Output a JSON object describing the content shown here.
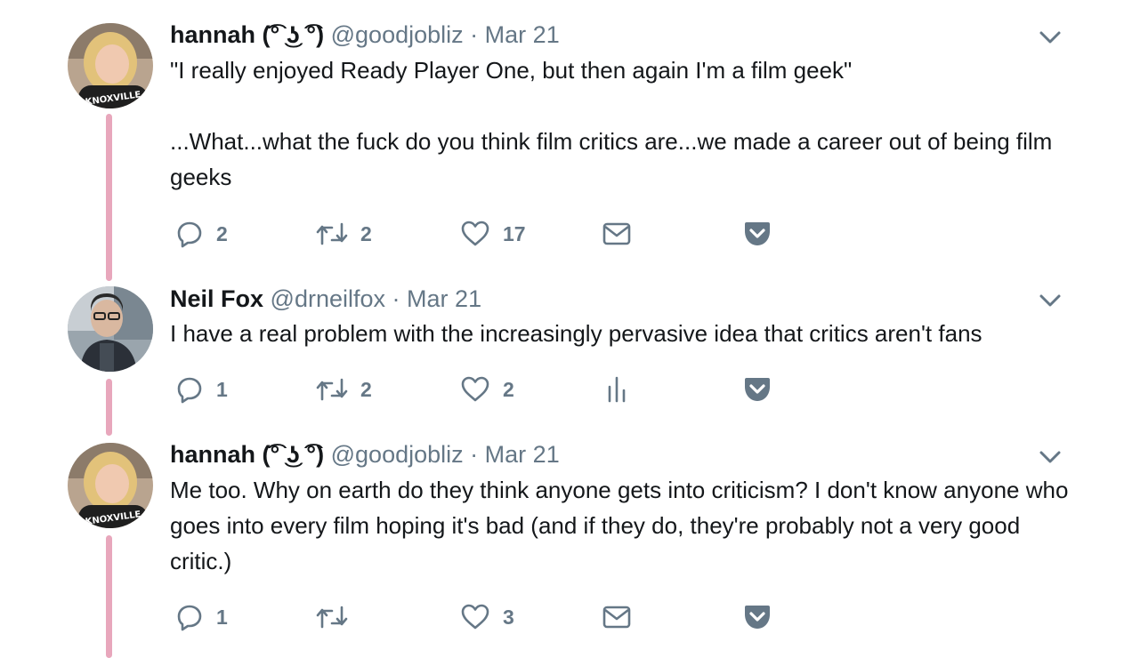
{
  "tweets": [
    {
      "name": "hannah (͡° ͜ʖ ͡°)",
      "handle": "@goodjobliz",
      "separator": "·",
      "date": "Mar 21",
      "paragraphs": [
        "\"I really enjoyed Ready Player One, but then again I'm a film geek\"",
        "...What...what the fuck do you think film critics are...we made a career out of being film geeks"
      ],
      "replies": "2",
      "retweets": "2",
      "likes": "17",
      "fourth_action_icon": "envelope-icon",
      "avatar_shirt_text": "KNOXVILLE"
    },
    {
      "name": "Neil Fox",
      "handle": "@drneilfox",
      "separator": "·",
      "date": "Mar 21",
      "paragraphs": [
        "I have a real problem with the increasingly pervasive idea that critics aren't fans"
      ],
      "replies": "1",
      "retweets": "2",
      "likes": "2",
      "fourth_action_icon": "analytics-icon"
    },
    {
      "name": "hannah (͡° ͜ʖ ͡°)",
      "handle": "@goodjobliz",
      "separator": "·",
      "date": "Mar 21",
      "paragraphs": [
        "Me too. Why on earth do they think anyone gets into criticism? I don't know anyone who goes into every film hoping it's bad (and if they do, they're probably not a very good critic.)"
      ],
      "replies": "1",
      "retweets": "",
      "likes": "3",
      "fourth_action_icon": "envelope-icon",
      "avatar_shirt_text": "KNOXVILLE"
    }
  ],
  "colors": {
    "thread_line": "#e8a7bc",
    "text": "#14171a",
    "secondary": "#657786",
    "pocket": "#657786"
  }
}
